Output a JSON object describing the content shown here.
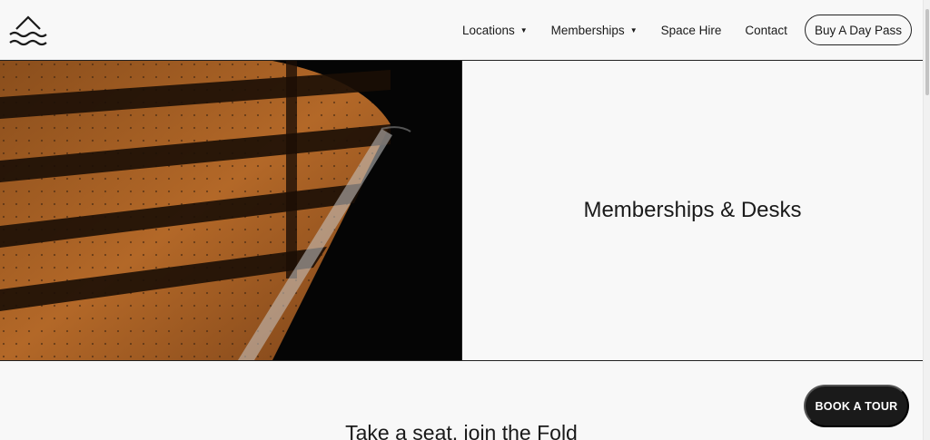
{
  "header": {
    "logo_icon": "wave-roof-logo-icon",
    "nav": {
      "locations": "Locations",
      "memberships": "Memberships",
      "space_hire": "Space Hire",
      "contact": "Contact",
      "caret_icon": "caret-down-icon"
    },
    "day_pass_label": "Buy A Day Pass"
  },
  "hero": {
    "image_desc": "amber-perforated-wall-with-railing-shadows",
    "title": "Memberships & Desks"
  },
  "section": {
    "title": "Take a seat, join the Fold"
  },
  "book_tour_label": "BOOK A TOUR",
  "colors": {
    "background": "#f8f8f8",
    "text": "#1a1a1a",
    "button_dark": "#1a1a1a",
    "hero_amber": "#b86a28"
  }
}
